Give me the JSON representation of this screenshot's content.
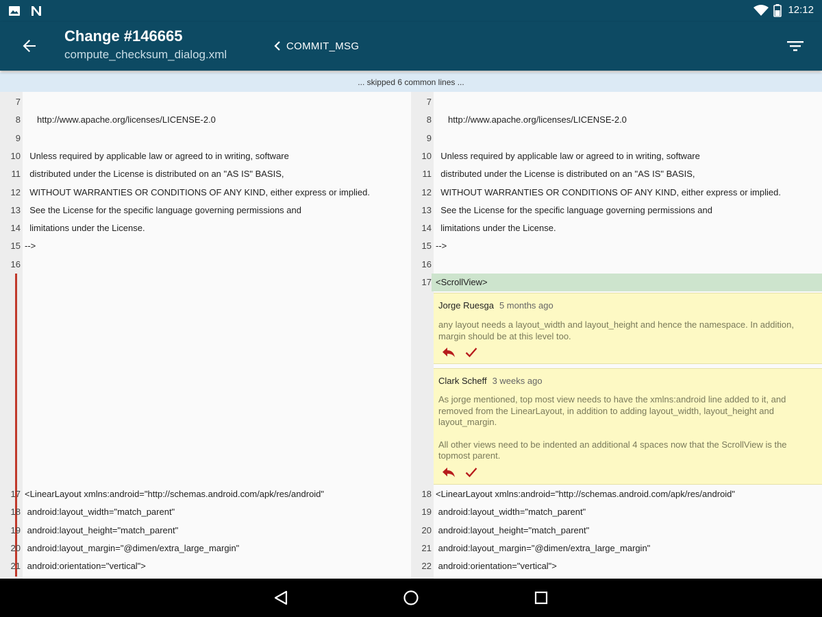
{
  "status_bar": {
    "time": "12:12",
    "left_icons": [
      "image-icon",
      "n-logo-icon"
    ],
    "right_icons": [
      "wifi-icon",
      "battery-icon"
    ]
  },
  "app_bar": {
    "title": "Change #146665",
    "subtitle": "compute_checksum_dialog.xml",
    "commit_msg_label": "COMMIT_MSG"
  },
  "skipped_text": "... skipped 6 common lines ...",
  "left_lines": [
    {
      "num": "7",
      "code": ""
    },
    {
      "num": "8",
      "code": "     http://www.apache.org/licenses/LICENSE-2.0"
    },
    {
      "num": "9",
      "code": ""
    },
    {
      "num": "10",
      "code": "  Unless required by applicable law or agreed to in writing, software"
    },
    {
      "num": "11",
      "code": "  distributed under the License is distributed on an \"AS IS\" BASIS,"
    },
    {
      "num": "12",
      "code": "  WITHOUT WARRANTIES OR CONDITIONS OF ANY KIND, either express or implied."
    },
    {
      "num": "13",
      "code": "  See the License for the specific language governing permissions and"
    },
    {
      "num": "14",
      "code": "  limitations under the License."
    },
    {
      "num": "15",
      "code": "-->"
    },
    {
      "num": "16",
      "code": ""
    }
  ],
  "left_lines_bottom": [
    {
      "num": "17",
      "code": "<LinearLayout xmlns:android=\"http://schemas.android.com/apk/res/android\""
    },
    {
      "num": "18",
      "code": " android:layout_width=\"match_parent\""
    },
    {
      "num": "19",
      "code": " android:layout_height=\"match_parent\""
    },
    {
      "num": "20",
      "code": " android:layout_margin=\"@dimen/extra_large_margin\""
    },
    {
      "num": "21",
      "code": " android:orientation=\"vertical\">"
    }
  ],
  "right_lines": [
    {
      "num": "7",
      "code": ""
    },
    {
      "num": "8",
      "code": "     http://www.apache.org/licenses/LICENSE-2.0"
    },
    {
      "num": "9",
      "code": ""
    },
    {
      "num": "10",
      "code": "  Unless required by applicable law or agreed to in writing, software"
    },
    {
      "num": "11",
      "code": "  distributed under the License is distributed on an \"AS IS\" BASIS,"
    },
    {
      "num": "12",
      "code": "  WITHOUT WARRANTIES OR CONDITIONS OF ANY KIND, either express or implied."
    },
    {
      "num": "13",
      "code": "  See the License for the specific language governing permissions and"
    },
    {
      "num": "14",
      "code": "  limitations under the License."
    },
    {
      "num": "15",
      "code": "-->"
    },
    {
      "num": "16",
      "code": ""
    },
    {
      "num": "17",
      "code": "<ScrollView>"
    }
  ],
  "right_lines_bottom": [
    {
      "num": "18",
      "code": "<LinearLayout xmlns:android=\"http://schemas.android.com/apk/res/android\""
    },
    {
      "num": "19",
      "code": " android:layout_width=\"match_parent\""
    },
    {
      "num": "20",
      "code": " android:layout_height=\"match_parent\""
    },
    {
      "num": "21",
      "code": " android:layout_margin=\"@dimen/extra_large_margin\""
    },
    {
      "num": "22",
      "code": " android:orientation=\"vertical\">"
    }
  ],
  "comments": [
    {
      "author": "Jorge Ruesga",
      "time": "5 months ago",
      "paragraphs": [
        "any layout needs a layout_width and layout_height and hence the namespace. In addition, margin should be at this level too."
      ]
    },
    {
      "author": "Clark Scheff",
      "time": "3 weeks ago",
      "paragraphs": [
        "As jorge mentioned, top most view needs to have the xmlns:android line added to it, and removed from the LinearLayout, in addition to adding layout_width, layout_height and layout_margin.",
        "All other views need to be indented an additional 4 spaces now that the ScrollView is the topmost parent."
      ]
    }
  ],
  "colors": {
    "app_bar": "#0d4a63",
    "added_line": "#cde4cd",
    "comment_bg": "#fdf9c4",
    "skipped_bar": "#dceaf5",
    "removed_marker": "#c0392b",
    "action_icon": "#b71c1c"
  }
}
